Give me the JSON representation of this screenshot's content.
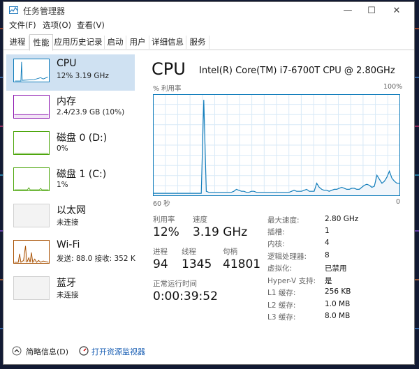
{
  "window": {
    "title": "任务管理器",
    "controls": {
      "minimize": "—",
      "maximize": "☐",
      "close": "✕"
    }
  },
  "menu": [
    "文件(F)",
    "选项(O)",
    "查看(V)"
  ],
  "tabs": [
    {
      "label": "进程",
      "active": false
    },
    {
      "label": "性能",
      "active": true
    },
    {
      "label": "应用历史记录",
      "active": false
    },
    {
      "label": "启动",
      "active": false
    },
    {
      "label": "用户",
      "active": false
    },
    {
      "label": "详细信息",
      "active": false
    },
    {
      "label": "服务",
      "active": false
    }
  ],
  "sidebar": {
    "items": [
      {
        "name": "CPU",
        "value": "12% 3.19 GHz",
        "selected": true,
        "color": "#117dbb"
      },
      {
        "name": "内存",
        "value": "2.4/23.9 GB (10%)",
        "selected": false,
        "color": "#8b12ae"
      },
      {
        "name": "磁盘 0 (D:)",
        "value": "0%",
        "selected": false,
        "color": "#4da60c"
      },
      {
        "name": "磁盘 1 (C:)",
        "value": "1%",
        "selected": false,
        "color": "#4da60c"
      },
      {
        "name": "以太网",
        "value": "未连接",
        "selected": false,
        "color": "#a74f01"
      },
      {
        "name": "Wi-Fi",
        "value": "发送: 88.0 接收: 352 K",
        "selected": false,
        "color": "#a74f01"
      },
      {
        "name": "蓝牙",
        "value": "未连接",
        "selected": false,
        "color": "#a74f01"
      }
    ]
  },
  "main": {
    "title": "CPU",
    "model": "Intel(R) Core(TM) i7-6700T CPU @ 2.80GHz",
    "graph": {
      "ylabel": "% 利用率",
      "ymax_label": "100%",
      "xstart_label": "60 秒",
      "xend_label": "0",
      "line_color": "#117dbb",
      "samples": [
        2,
        2,
        2,
        2,
        2,
        2,
        2,
        2,
        2,
        2,
        2,
        2,
        2,
        2,
        2,
        2,
        2,
        2,
        2,
        2,
        95,
        4,
        3,
        3,
        3,
        3,
        3,
        3,
        3,
        3,
        3,
        3,
        4,
        6,
        5,
        4,
        4,
        3,
        3,
        4,
        4,
        3,
        3,
        3,
        3,
        3,
        3,
        3,
        3,
        3,
        3,
        3,
        3,
        3,
        3,
        4,
        5,
        4,
        4,
        4,
        5,
        6,
        4,
        4,
        4,
        12,
        8,
        6,
        5,
        5,
        4,
        5,
        6,
        6,
        7,
        8,
        7,
        6,
        6,
        7,
        7,
        6,
        6,
        8,
        10,
        11,
        10,
        8,
        9,
        20,
        16,
        12,
        14,
        18,
        24,
        17,
        14,
        12,
        12
      ]
    },
    "stats": [
      {
        "label": "利用率",
        "value": "12%"
      },
      {
        "label": "速度",
        "value": "3.19 GHz"
      },
      {
        "label": "进程",
        "value": "94"
      },
      {
        "label": "线程",
        "value": "1345"
      },
      {
        "label": "句柄",
        "value": "41801"
      },
      {
        "label": "正常运行时间",
        "value": "0:00:39:52"
      }
    ],
    "specs": [
      {
        "key": "最大速度:",
        "value": "2.80 GHz"
      },
      {
        "key": "插槽:",
        "value": "1"
      },
      {
        "key": "内核:",
        "value": "4"
      },
      {
        "key": "逻辑处理器:",
        "value": "8"
      },
      {
        "key": "虚拟化:",
        "value": "已禁用"
      },
      {
        "key": "Hyper-V 支持:",
        "value": "是"
      },
      {
        "key": "L1 缓存:",
        "value": "256 KB"
      },
      {
        "key": "L2 缓存:",
        "value": "1.0 MB"
      },
      {
        "key": "L3 缓存:",
        "value": "8.0 MB"
      }
    ]
  },
  "footer": {
    "brief_label": "简略信息(D)",
    "resmon_label": "打开资源监视器"
  }
}
